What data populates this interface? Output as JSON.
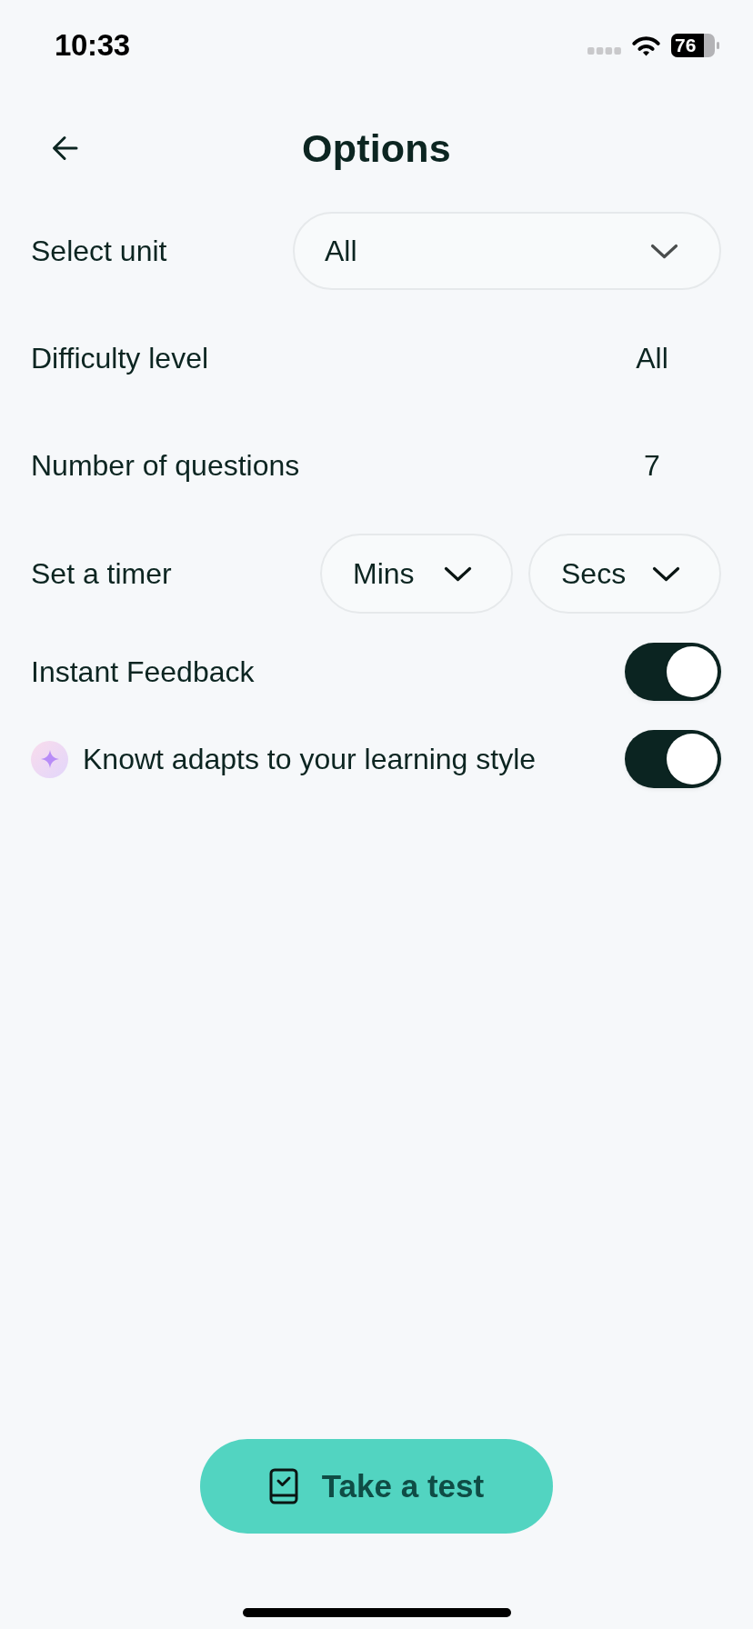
{
  "status_bar": {
    "time": "10:33",
    "battery": "76"
  },
  "header": {
    "title": "Options"
  },
  "options": [
    {
      "kind": "select",
      "label": "Select unit",
      "value": "All"
    },
    {
      "kind": "value",
      "label": "Difficulty level",
      "value": "All"
    },
    {
      "kind": "value",
      "label": "Number of questions",
      "value": "7"
    },
    {
      "kind": "timer",
      "label": "Set a timer",
      "selects": [
        {
          "placeholder": "Mins"
        },
        {
          "placeholder": "Secs"
        }
      ]
    },
    {
      "kind": "toggle",
      "label": "Instant Feedback",
      "on": true,
      "sparkle": false
    },
    {
      "kind": "toggle",
      "label": "Knowt adapts to your learning style",
      "on": true,
      "sparkle": true
    }
  ],
  "primary_button": {
    "label": "Take a test"
  }
}
